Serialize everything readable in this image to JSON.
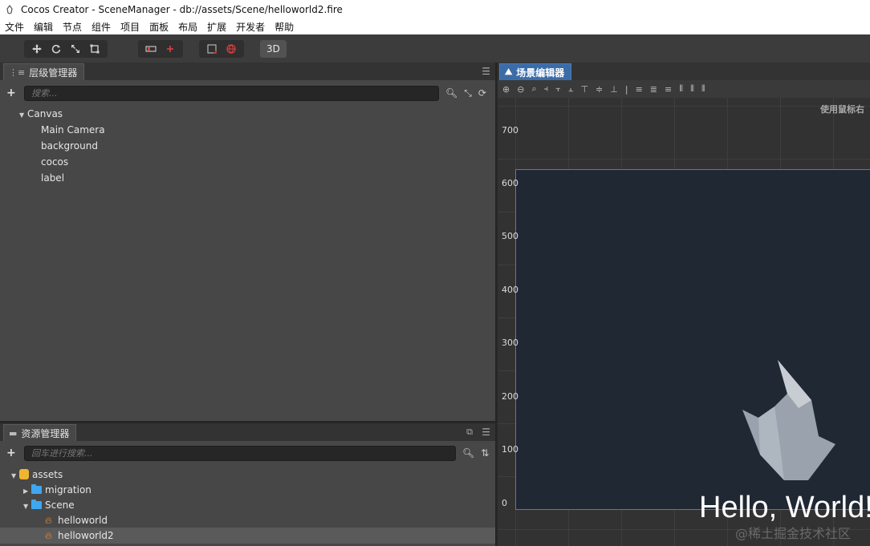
{
  "window": {
    "title": "Cocos Creator - SceneManager - db://assets/Scene/helloworld2.fire"
  },
  "menu": {
    "items": [
      "文件",
      "编辑",
      "节点",
      "组件",
      "项目",
      "面板",
      "布局",
      "扩展",
      "开发者",
      "帮助"
    ]
  },
  "toolbar": {
    "mode_3d_label": "3D"
  },
  "hierarchy": {
    "tab_label": "层级管理器",
    "search_placeholder": "搜索...",
    "nodes": [
      {
        "label": "Canvas",
        "depth": 0,
        "expanded": true
      },
      {
        "label": "Main Camera",
        "depth": 1
      },
      {
        "label": "background",
        "depth": 1
      },
      {
        "label": "cocos",
        "depth": 1
      },
      {
        "label": "label",
        "depth": 1
      }
    ]
  },
  "assets": {
    "tab_label": "资源管理器",
    "search_placeholder": "回车进行搜索...",
    "items": [
      {
        "label": "assets",
        "type": "db",
        "expanded": true
      },
      {
        "label": "migration",
        "type": "folder",
        "expanded": false
      },
      {
        "label": "Scene",
        "type": "folder",
        "expanded": true
      },
      {
        "label": "helloworld",
        "type": "scene"
      },
      {
        "label": "helloworld2",
        "type": "scene",
        "selected": true
      }
    ]
  },
  "scene_editor": {
    "tab_label": "场景编辑器",
    "hint": "使用鼠标右",
    "ruler_ticks": [
      "700",
      "600",
      "500",
      "400",
      "300",
      "200",
      "100",
      "0"
    ],
    "label_text": "Hello, World!",
    "watermark": "@稀土掘金技术社区"
  },
  "colors": {
    "scene_tab": "#3c6ca8",
    "canvas_border": "#c040c0",
    "canvas_bg": "#1f2833",
    "folder": "#3ea7ef",
    "db": "#f0b430",
    "fire": "#f08a30"
  }
}
